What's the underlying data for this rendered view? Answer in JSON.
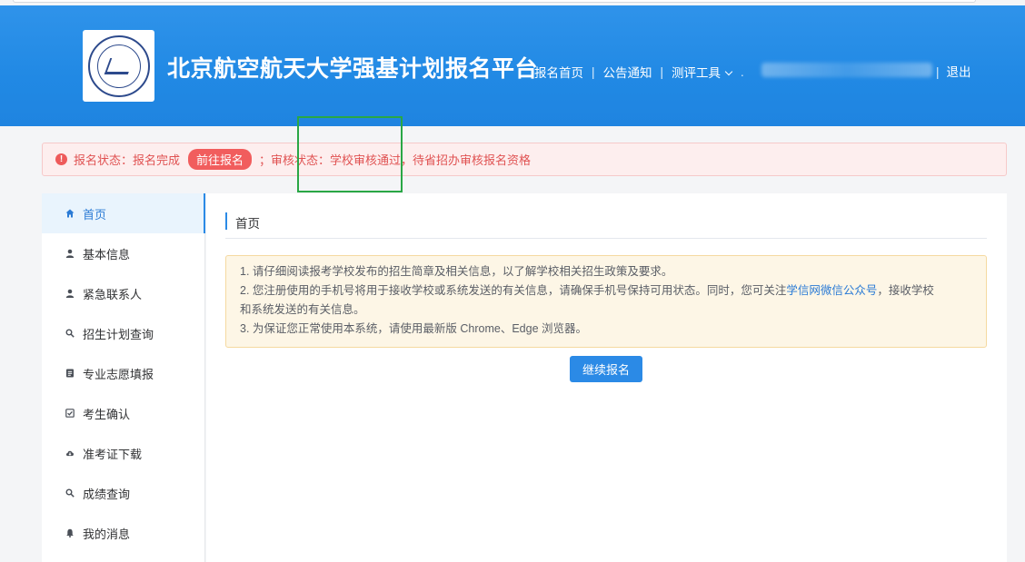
{
  "header": {
    "site_title": "北京航空航天大学强基计划报名平台",
    "nav": {
      "home": "报名首页",
      "announcements": "公告通知",
      "tools": "测评工具",
      "logout": "退出"
    },
    "logo_icon": "university-seal-icon"
  },
  "alert": {
    "status_label": "报名状态：报名完成",
    "goto_button": "前往报名",
    "review_status": "；审核状态：学校审核通过，待省招办审核报名资格"
  },
  "sidebar": {
    "items": [
      {
        "label": "首页",
        "icon": "home-icon"
      },
      {
        "label": "基本信息",
        "icon": "user-icon"
      },
      {
        "label": "紧急联系人",
        "icon": "user-icon"
      },
      {
        "label": "招生计划查询",
        "icon": "search-icon"
      },
      {
        "label": "专业志愿填报",
        "icon": "form-icon"
      },
      {
        "label": "考生确认",
        "icon": "check-icon"
      },
      {
        "label": "准考证下载",
        "icon": "cloud-download-icon"
      },
      {
        "label": "成绩查询",
        "icon": "search-icon"
      },
      {
        "label": "我的消息",
        "icon": "bell-icon"
      }
    ]
  },
  "main": {
    "page_title": "首页",
    "notice": {
      "line1": "1. 请仔细阅读报考学校发布的招生简章及相关信息，以了解学校相关招生政策及要求。",
      "line2_prefix": "2. 您注册使用的手机号将用于接收学校或系统发送的有关信息，请确保手机号保持可用状态。同时，您可关注",
      "line2_link": "学信网微信公众号",
      "line2_suffix": "，接收学校",
      "line2_cont": "和系统发送的有关信息。",
      "line3": "3. 为保证您正常使用本系统，请使用最新版 Chrome、Edge 浏览器。"
    },
    "continue_button": "继续报名"
  },
  "colors": {
    "header_blue": "#2189e4",
    "accent_blue": "#2b8ae6",
    "alert_red": "#e05252",
    "highlight_green": "#29a745"
  }
}
